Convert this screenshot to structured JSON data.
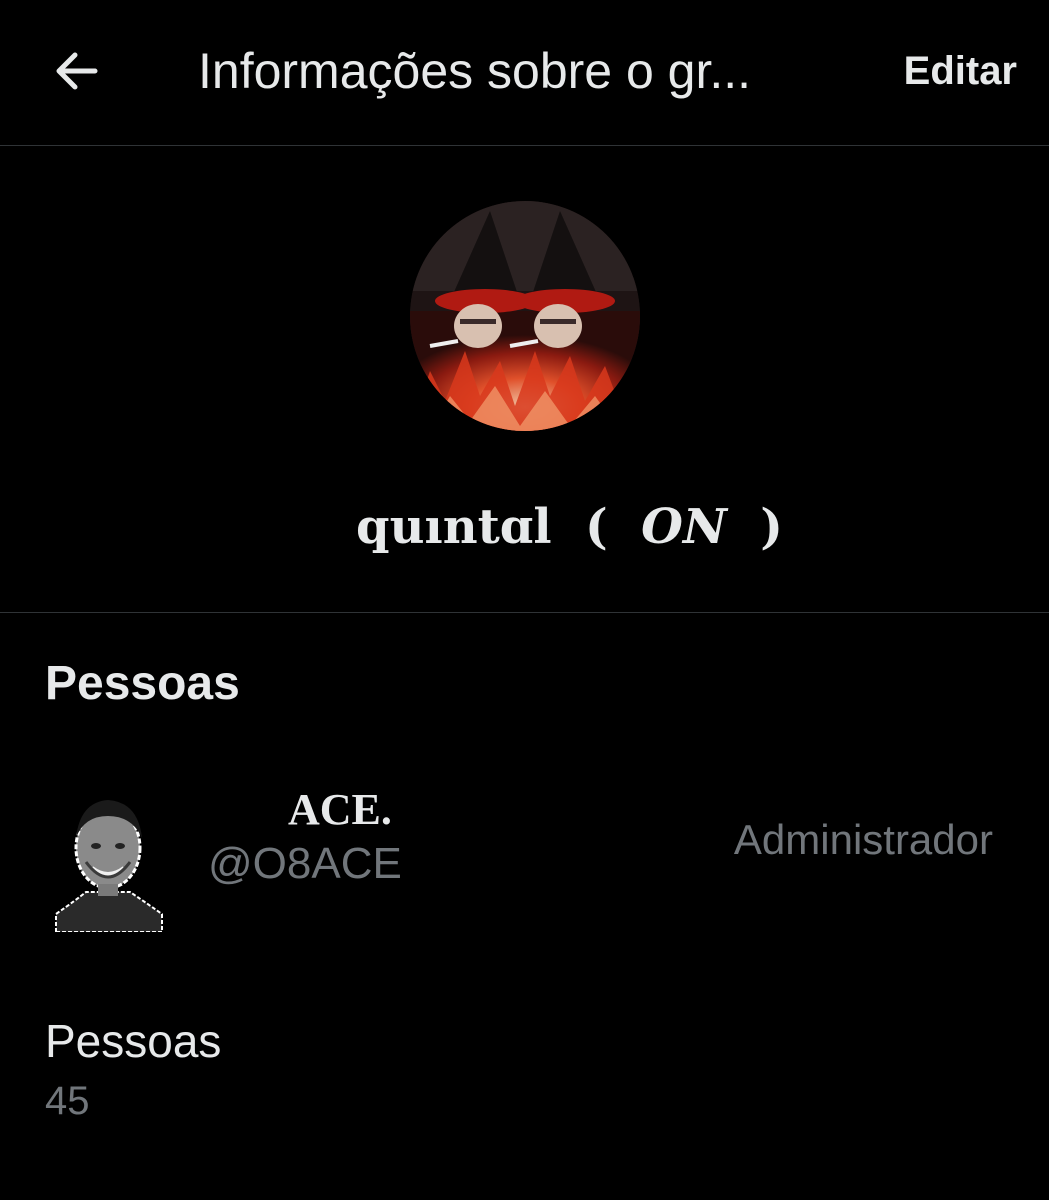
{
  "header": {
    "back_icon": "arrow-left-icon",
    "title": "Informações sobre o gr...",
    "edit_label": "Editar"
  },
  "group": {
    "avatar_description_icon": "group-avatar-image",
    "name_prefix": "quıntɑl",
    "name_open": "(",
    "name_on": "ON",
    "name_close": ")"
  },
  "people": {
    "section_title": "Pessoas",
    "members": [
      {
        "name": "ACE.",
        "handle": "@O8ACE",
        "role": "Administrador"
      }
    ],
    "count_label": "Pessoas",
    "count_value": "45"
  },
  "colors": {
    "background": "#000000",
    "primary_text": "#e7e9ea",
    "secondary_text": "#71767b",
    "divider": "#2f3336"
  }
}
